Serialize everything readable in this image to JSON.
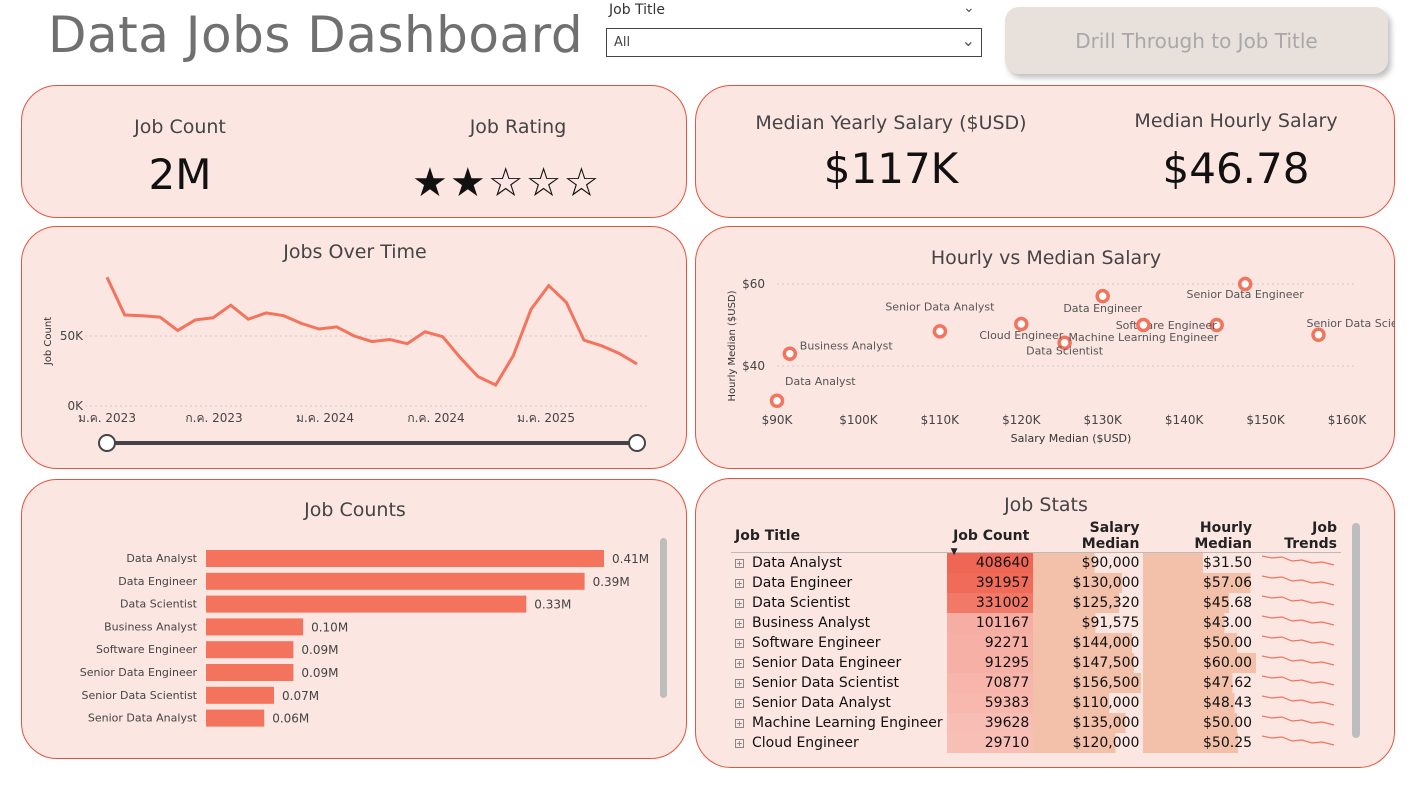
{
  "header": {
    "title": "Data Jobs Dashboard",
    "slicer_label": "Job Title",
    "slicer_value": "All",
    "drill_button": "Drill Through to Job Title"
  },
  "kpis": {
    "job_count_label": "Job Count",
    "job_count_value": "2M",
    "job_rating_label": "Job Rating",
    "job_rating_stars": 2,
    "job_rating_max": 5,
    "median_yearly_label": "Median Yearly Salary ($USD)",
    "median_yearly_value": "$117K",
    "median_hourly_label": "Median Hourly Salary",
    "median_hourly_value": "$46.78"
  },
  "colors": {
    "accent": "#f4735c",
    "card_bg": "#fce6e2",
    "card_border": "#e2553e"
  },
  "jobs_over_time": {
    "title": "Jobs Over Time",
    "ylabel": "Job Count",
    "yticks": [
      "50K",
      "0K"
    ],
    "xticks": [
      "ม.ค. 2023",
      "ก.ค. 2023",
      "ม.ค. 2024",
      "ก.ค. 2024",
      "ม.ค. 2025"
    ]
  },
  "scatter": {
    "title": "Hourly vs Median Salary",
    "xlabel": "Salary Median ($USD)",
    "ylabel": "Hourly Median ($USD)",
    "yticks": [
      "$60",
      "$40"
    ],
    "xticks": [
      "$90K",
      "$100K",
      "$110K",
      "$120K",
      "$130K",
      "$140K",
      "$150K",
      "$160K"
    ]
  },
  "job_counts": {
    "title": "Job Counts"
  },
  "job_stats": {
    "title": "Job Stats",
    "columns": [
      "Job Title",
      "Job Count",
      "Salary Median",
      "Hourly Median",
      "Job Trends"
    ],
    "rows": [
      {
        "title": "Data Analyst",
        "count": "408640",
        "salary": "$90,000",
        "hourly": "$31.50"
      },
      {
        "title": "Data Engineer",
        "count": "391957",
        "salary": "$130,000",
        "hourly": "$57.06"
      },
      {
        "title": "Data Scientist",
        "count": "331002",
        "salary": "$125,320",
        "hourly": "$45.68"
      },
      {
        "title": "Business Analyst",
        "count": "101167",
        "salary": "$91,575",
        "hourly": "$43.00"
      },
      {
        "title": "Software Engineer",
        "count": "92271",
        "salary": "$144,000",
        "hourly": "$50.00"
      },
      {
        "title": "Senior Data Engineer",
        "count": "91295",
        "salary": "$147,500",
        "hourly": "$60.00"
      },
      {
        "title": "Senior Data Scientist",
        "count": "70877",
        "salary": "$156,500",
        "hourly": "$47.62"
      },
      {
        "title": "Senior Data Analyst",
        "count": "59383",
        "salary": "$110,000",
        "hourly": "$48.43"
      },
      {
        "title": "Machine Learning Engineer",
        "count": "39628",
        "salary": "$135,000",
        "hourly": "$50.00"
      },
      {
        "title": "Cloud Engineer",
        "count": "29710",
        "salary": "$120,000",
        "hourly": "$50.25"
      }
    ]
  },
  "chart_data": [
    {
      "type": "line",
      "title": "Jobs Over Time",
      "ylabel": "Job Count",
      "ylim": [
        0,
        95000
      ],
      "x": [
        "2023-01",
        "2023-02",
        "2023-03",
        "2023-04",
        "2023-05",
        "2023-06",
        "2023-07",
        "2023-08",
        "2023-09",
        "2023-10",
        "2023-11",
        "2023-12",
        "2024-01",
        "2024-02",
        "2024-03",
        "2024-04",
        "2024-05",
        "2024-06",
        "2024-07",
        "2024-08",
        "2024-09",
        "2024-10",
        "2024-11",
        "2024-12",
        "2025-01",
        "2025-02",
        "2025-03",
        "2025-04",
        "2025-05",
        "2025-06",
        "2025-07"
      ],
      "values": [
        92000,
        65000,
        64500,
        63500,
        54000,
        61500,
        63000,
        72000,
        62000,
        66500,
        64500,
        59000,
        55000,
        56500,
        50000,
        46000,
        47500,
        44500,
        53000,
        49500,
        34500,
        21000,
        15000,
        36000,
        69000,
        86000,
        74000,
        47000,
        43000,
        37500,
        30000
      ]
    },
    {
      "type": "scatter",
      "title": "Hourly vs Median Salary",
      "xlabel": "Salary Median ($USD)",
      "ylabel": "Hourly Median ($USD)",
      "xlim": [
        90000,
        160000
      ],
      "ylim": [
        33,
        60
      ],
      "points": [
        {
          "label": "Data Analyst",
          "x": 90000,
          "y": 31.5
        },
        {
          "label": "Data Engineer",
          "x": 130000,
          "y": 57.06
        },
        {
          "label": "Data Scientist",
          "x": 125320,
          "y": 45.68
        },
        {
          "label": "Business Analyst",
          "x": 91575,
          "y": 43.0
        },
        {
          "label": "Software Engineer",
          "x": 144000,
          "y": 50.0
        },
        {
          "label": "Senior Data Engineer",
          "x": 147500,
          "y": 60.0
        },
        {
          "label": "Senior Data Scientist",
          "x": 156500,
          "y": 47.62
        },
        {
          "label": "Senior Data Analyst",
          "x": 110000,
          "y": 48.43
        },
        {
          "label": "Machine Learning Engineer",
          "x": 135000,
          "y": 50.0
        },
        {
          "label": "Cloud Engineer",
          "x": 120000,
          "y": 50.25
        }
      ]
    },
    {
      "type": "bar",
      "title": "Job Counts",
      "categories": [
        "Data Analyst",
        "Data Engineer",
        "Data Scientist",
        "Business Analyst",
        "Software Engineer",
        "Senior Data Engineer",
        "Senior Data Scientist",
        "Senior Data Analyst"
      ],
      "values": [
        0.41,
        0.39,
        0.33,
        0.1,
        0.09,
        0.09,
        0.07,
        0.06
      ],
      "labels": [
        "0.41M",
        "0.39M",
        "0.33M",
        "0.10M",
        "0.09M",
        "0.09M",
        "0.07M",
        "0.06M"
      ]
    }
  ]
}
